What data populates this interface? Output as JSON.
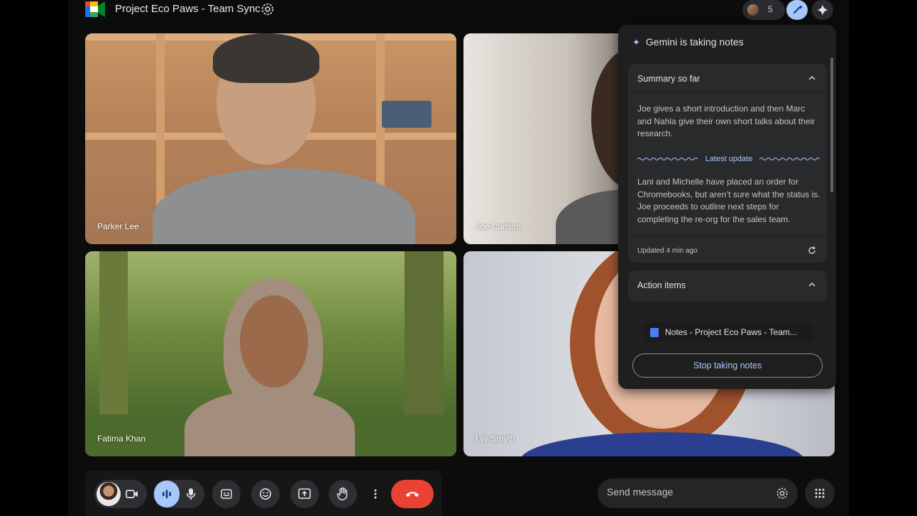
{
  "meeting": {
    "title": "Project Eco Paws - Team Sync",
    "participant_count": "5"
  },
  "participants": [
    {
      "name": "Parker Lee"
    },
    {
      "name": "Joe Carlson"
    },
    {
      "name": "Fatima Khan"
    },
    {
      "name": "Lily Smyth"
    }
  ],
  "gemini_panel": {
    "header": "Gemini is taking notes",
    "summary": {
      "title": "Summary so far",
      "text": "Joe gives a short introduction and then Marc and Nahla give their own short talks about their research.",
      "latest_label": "Latest update",
      "latest_text": "Lani and Michelle have placed an order for Chromebooks, but aren’t sure what the status is. Joe proceeds to outline next steps for completing the re-org for the sales team.",
      "updated": "Updated 4 min ago"
    },
    "action_items": {
      "title": "Action items"
    },
    "doc_link": "Notes - Project Eco Paws - Team...",
    "stop_button": "Stop taking notes"
  },
  "chat": {
    "placeholder": "Send message"
  },
  "colors": {
    "accent": "#a8c7fa",
    "hangup": "#e94235",
    "panel_bg": "#1f1f1f"
  },
  "icons": [
    "meet-logo-icon",
    "settings-icon",
    "people-icon",
    "notes-icon",
    "sparkle-icon",
    "camera-icon",
    "mic-icon",
    "captions-icon",
    "emoji-icon",
    "present-icon",
    "raise-hand-icon",
    "more-icon",
    "hangup-icon",
    "apps-icon",
    "chevron-up-icon",
    "refresh-icon",
    "doc-icon"
  ]
}
